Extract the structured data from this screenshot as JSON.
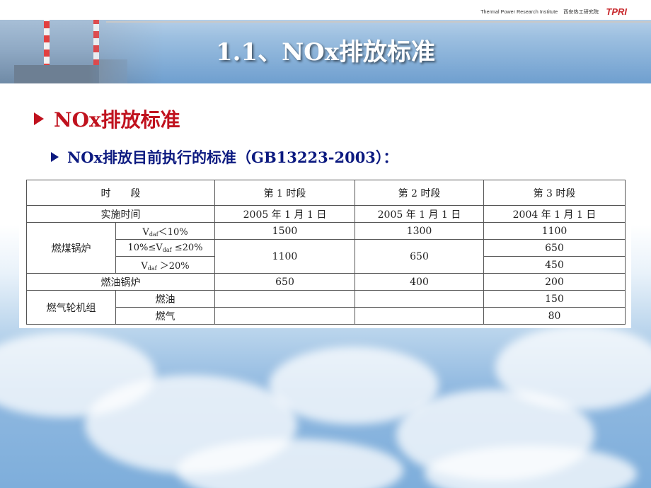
{
  "header": {
    "org_en": "Thermal Power Research Institute",
    "org_cn": "西安热工研究院",
    "logo": "TPRI",
    "title": "1.1、NOx排放标准"
  },
  "section": {
    "heading": "NOx排放标准",
    "subheading": "NOx排放目前执行的标准（GB13223-2003）："
  },
  "table": {
    "headers": [
      "时　　段",
      "第 1 时段",
      "第 2 时段",
      "第 3 时段"
    ],
    "impl_label": "实施时间",
    "impl_dates": [
      "2005 年 1 月 1 日",
      "2005 年 1 月 1 日",
      "2004 年 1 月 1 日"
    ],
    "coal_label": "燃煤锅炉",
    "coal_rows": [
      {
        "pre": "V",
        "sub": "daf",
        "post": "＜10%",
        "p1": "1500",
        "p2": "1300",
        "p3": "1100"
      },
      {
        "pre": "10%≤V",
        "sub": "daf",
        "post": " ≤20%",
        "p3": "650"
      },
      {
        "pre": "V",
        "sub": "daf",
        "post": " ＞20%",
        "p3": "450"
      }
    ],
    "coal_merged": {
      "p1": "1100",
      "p2": "650"
    },
    "oil_boiler": {
      "label": "燃油锅炉",
      "p1": "650",
      "p2": "400",
      "p3": "200"
    },
    "turbine_label": "燃气轮机组",
    "turbine_rows": [
      {
        "fuel": "燃油",
        "p3": "150"
      },
      {
        "fuel": "燃气",
        "p3": "80"
      }
    ]
  },
  "colors": {
    "heading": "#c0121e",
    "subheading": "#0c1a80",
    "logo": "#c8282c"
  }
}
